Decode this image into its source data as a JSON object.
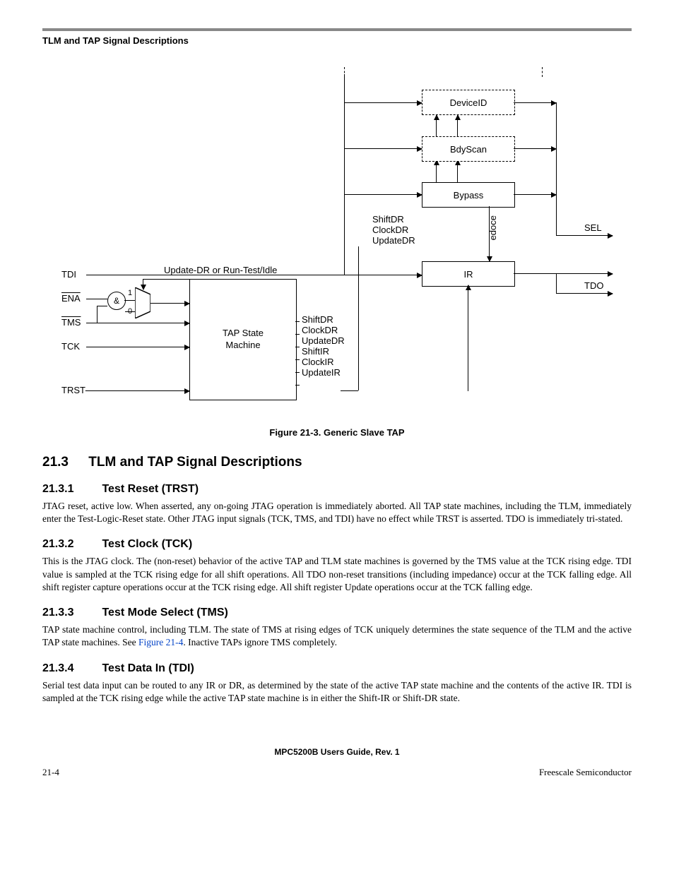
{
  "header": {
    "running_title": "TLM and TAP Signal Descriptions"
  },
  "figure": {
    "caption": "Figure 21-3. Generic Slave TAP",
    "labels": {
      "tdi": "TDI",
      "ena": "ENA",
      "tms": "TMS",
      "tck": "TCK",
      "trst": "TRST-",
      "and": "&",
      "mux1": "1",
      "mux0": "0",
      "updatedr_runtest": "Update-DR or Run-Test/Idle",
      "tap_state_machine": "TAP State\nMachine",
      "right_group": [
        "ShiftDR",
        "ClockDR",
        "UpdateDR",
        "ShiftIR",
        "ClockIR",
        "UpdateIR"
      ],
      "mid_group": [
        "ShiftDR",
        "ClockDR",
        "UpdateDR"
      ],
      "deviceid": "DeviceID",
      "bdyscan": "BdyScan",
      "bypass": "Bypass",
      "ir": "IR",
      "edoce": "edoce",
      "sel": "SEL",
      "tdo": "TDO"
    }
  },
  "sections": {
    "s21_3": {
      "num": "21.3",
      "title": "TLM and TAP Signal Descriptions"
    },
    "s21_3_1": {
      "num": "21.3.1",
      "title": "Test Reset (TRST)",
      "body": "JTAG reset, active low. When asserted, any on-going JTAG operation is immediately aborted. All TAP state machines, including the TLM, immediately enter the Test-Logic-Reset state. Other JTAG input signals (TCK, TMS, and TDI) have no effect while TRST is asserted. TDO is immediately tri-stated."
    },
    "s21_3_2": {
      "num": "21.3.2",
      "title": "Test Clock (TCK)",
      "body": "This is the JTAG clock. The (non-reset) behavior of the active TAP and TLM state machines is governed by the TMS value at the TCK rising edge. TDI value is sampled at the TCK rising edge for all shift operations. All TDO non-reset transitions (including impedance) occur at the TCK falling edge. All shift register capture operations occur at the TCK rising edge. All shift register Update operations occur at the TCK falling edge."
    },
    "s21_3_3": {
      "num": "21.3.3",
      "title": "Test Mode Select (TMS)",
      "body_pre": "TAP state machine control, including TLM. The state of TMS at rising edges of TCK uniquely determines the state sequence of the TLM and the active TAP state machines. See ",
      "xref": "Figure 21-4",
      "body_post": ". Inactive TAPs ignore TMS completely."
    },
    "s21_3_4": {
      "num": "21.3.4",
      "title": "Test Data In (TDI)",
      "body": "Serial test data input can be routed to any IR or DR, as determined by the state of the active TAP state machine and the contents of the active IR. TDI is sampled at the TCK rising edge while the active TAP state machine is in either the Shift-IR or Shift-DR state."
    }
  },
  "footer": {
    "guide": "MPC5200B Users Guide, Rev. 1",
    "page": "21-4",
    "org": "Freescale Semiconductor"
  }
}
